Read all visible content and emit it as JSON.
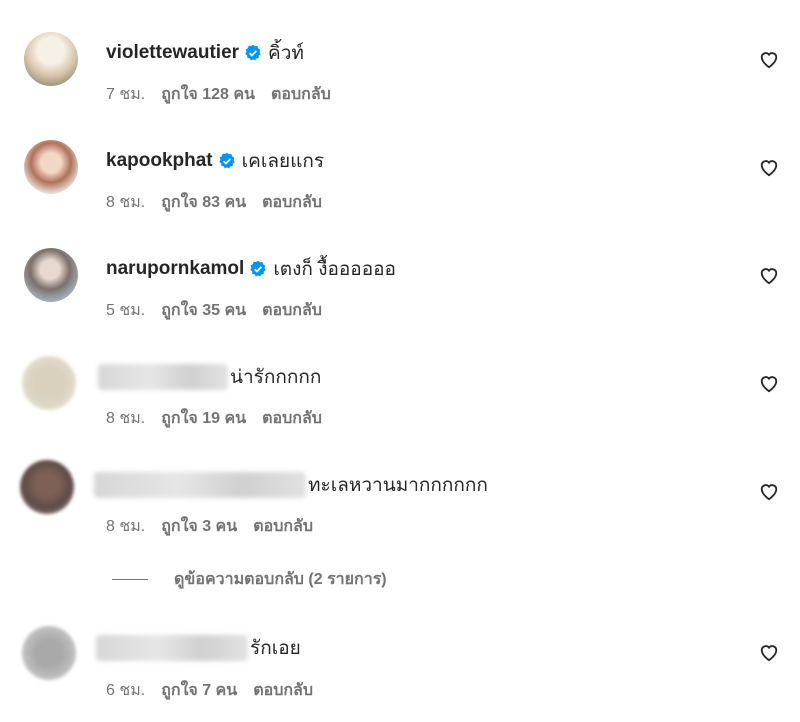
{
  "comments": [
    {
      "username": "violettewautier",
      "verified": true,
      "text": "คิ้วท์",
      "time": "7 ชม.",
      "likes": "ถูกใจ 128 คน",
      "reply": "ตอบกลับ"
    },
    {
      "username": "kapookphat",
      "verified": true,
      "text": "เคเลยแกร",
      "time": "8 ชม.",
      "likes": "ถูกใจ 83 คน",
      "reply": "ตอบกลับ"
    },
    {
      "username": "narupornkamol",
      "verified": true,
      "text": "เตงก็ งื้ออออออ",
      "time": "5 ชม.",
      "likes": "ถูกใจ 35 คน",
      "reply": "ตอบกลับ"
    },
    {
      "username": "",
      "verified": false,
      "text": "น่ารักกกกก",
      "time": "8 ชม.",
      "likes": "ถูกใจ 19 คน",
      "reply": "ตอบกลับ"
    },
    {
      "username": "",
      "verified": false,
      "text": "ทะเลหวานมากกกกกก",
      "time": "8 ชม.",
      "likes": "ถูกใจ 3 คน",
      "reply": "ตอบกลับ"
    },
    {
      "username": "",
      "verified": false,
      "text": "รักเอย",
      "time": "6 ชม.",
      "likes": "ถูกใจ 7 คน",
      "reply": "ตอบกลับ"
    }
  ],
  "view_replies": "ดูข้อความตอบกลับ (2 รายการ)",
  "colors": {
    "verified": "#0095f6",
    "text": "#262626",
    "secondary": "#737373"
  },
  "icons": {
    "like": "heart-outline-icon",
    "verified": "verified-badge-icon"
  }
}
